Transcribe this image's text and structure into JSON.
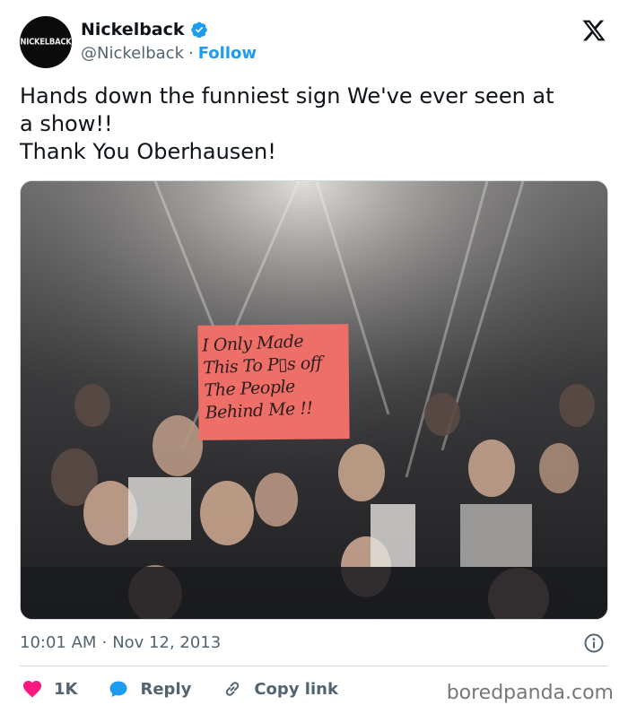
{
  "author": {
    "display_name": "Nickelback",
    "handle": "@Nickelback",
    "separator": "·",
    "follow_label": "Follow",
    "avatar_text": "NICKELBACK",
    "verified_color": "#1d9bf0"
  },
  "tweet": {
    "text": "Hands down the funniest sign We've ever seen at\na show!!\nThank You Oberhausen!"
  },
  "media": {
    "sign_text": "I Only Made\nThis To P▯s off\nThe People\nBehind Me !!"
  },
  "meta": {
    "time": "10:01 AM",
    "separator": "·",
    "date": "Nov 12, 2013"
  },
  "actions": {
    "likes": "1K",
    "reply_label": "Reply",
    "copy_label": "Copy link",
    "like_color": "#f91880",
    "reply_color": "#1d9bf0"
  },
  "icons": [
    "verified-badge-icon",
    "x-logo-icon",
    "info-icon",
    "heart-icon",
    "reply-bubble-icon",
    "link-icon"
  ],
  "watermark": "boredpanda.com"
}
